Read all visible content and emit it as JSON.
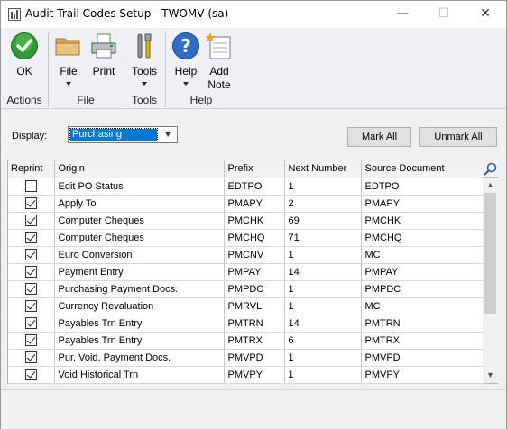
{
  "window": {
    "title": "Audit Trail Codes Setup  -  TWOMV (sa)",
    "minimize": "—",
    "maximize": "☐",
    "close": "✕"
  },
  "ribbon": {
    "ok": "OK",
    "file": "File",
    "print": "Print",
    "tools": "Tools",
    "help": "Help",
    "add_note": "Add Note",
    "groups": {
      "actions": "Actions",
      "file": "File",
      "tools": "Tools",
      "help": "Help"
    }
  },
  "display": {
    "label": "Display:",
    "value": "Purchasing"
  },
  "buttons": {
    "mark_all": "Mark All",
    "unmark_all": "Unmark All"
  },
  "grid": {
    "columns": [
      "Reprint",
      "Origin",
      "Prefix",
      "Next Number",
      "Source Document"
    ],
    "rows": [
      {
        "reprint": false,
        "origin": "Edit PO Status",
        "prefix": "EDTPO",
        "next": "1",
        "source": "EDTPO"
      },
      {
        "reprint": true,
        "origin": "Apply To",
        "prefix": "PMAPY",
        "next": "2",
        "source": "PMAPY"
      },
      {
        "reprint": true,
        "origin": "Computer Cheques",
        "prefix": "PMCHK",
        "next": "69",
        "source": "PMCHK"
      },
      {
        "reprint": true,
        "origin": "Computer Cheques",
        "prefix": "PMCHQ",
        "next": "71",
        "source": "PMCHQ"
      },
      {
        "reprint": true,
        "origin": "Euro Conversion",
        "prefix": "PMCNV",
        "next": "1",
        "source": "MC"
      },
      {
        "reprint": true,
        "origin": "Payment Entry",
        "prefix": "PMPAY",
        "next": "14",
        "source": "PMPAY"
      },
      {
        "reprint": true,
        "origin": "Purchasing Payment Docs.",
        "prefix": "PMPDC",
        "next": "1",
        "source": "PMPDC"
      },
      {
        "reprint": true,
        "origin": "Currency Revaluation",
        "prefix": "PMRVL",
        "next": "1",
        "source": "MC"
      },
      {
        "reprint": true,
        "origin": "Payables Trn Entry",
        "prefix": "PMTRN",
        "next": "14",
        "source": "PMTRN"
      },
      {
        "reprint": true,
        "origin": "Payables Trn Entry",
        "prefix": "PMTRX",
        "next": "6",
        "source": "PMTRX"
      },
      {
        "reprint": true,
        "origin": "Pur. Void. Payment Docs.",
        "prefix": "PMVPD",
        "next": "1",
        "source": "PMVPD"
      },
      {
        "reprint": true,
        "origin": "Void Historical Trn",
        "prefix": "PMVPY",
        "next": "1",
        "source": "PMVPY"
      }
    ]
  }
}
